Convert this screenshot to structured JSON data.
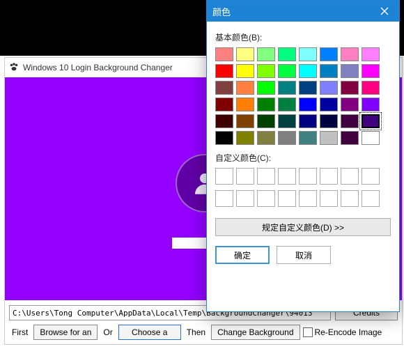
{
  "window": {
    "title": "Windows 10 Login Background Changer"
  },
  "preview": {
    "background_color": "#9400ff"
  },
  "bottom": {
    "path": "C:\\Users\\Tong Computer\\AppData\\Local\\Temp\\BackgroundChanger\\94013",
    "credits": "Credits",
    "first": "First",
    "browse": "Browse for an",
    "or": "Or",
    "choose": "Choose a",
    "then": "Then",
    "change": "Change Background",
    "reencode": "Re-Encode Image"
  },
  "dialog": {
    "title": "颜色",
    "basic_label": "基本颜色(B):",
    "custom_label": "自定义颜色(C):",
    "define": "规定自定义颜色(D) >>",
    "ok": "确定",
    "cancel": "取消",
    "selected_index": 39,
    "basic_colors": [
      "#ff8080",
      "#ffff80",
      "#80ff80",
      "#00ff80",
      "#80ffff",
      "#0080ff",
      "#ff80c0",
      "#ff80ff",
      "#ff0000",
      "#ffff00",
      "#80ff00",
      "#00ff40",
      "#00ffff",
      "#0080c0",
      "#8080c0",
      "#ff00ff",
      "#804040",
      "#ff8040",
      "#00ff00",
      "#008080",
      "#004080",
      "#8080ff",
      "#800040",
      "#ff0080",
      "#800000",
      "#ff8000",
      "#008000",
      "#008040",
      "#0000ff",
      "#0000a0",
      "#800080",
      "#8000ff",
      "#400000",
      "#804000",
      "#004000",
      "#004040",
      "#000080",
      "#000040",
      "#400040",
      "#400080",
      "#000000",
      "#808000",
      "#808040",
      "#808080",
      "#408080",
      "#c0c0c0",
      "#400040",
      "#ffffff"
    ],
    "custom_slots": 16
  }
}
